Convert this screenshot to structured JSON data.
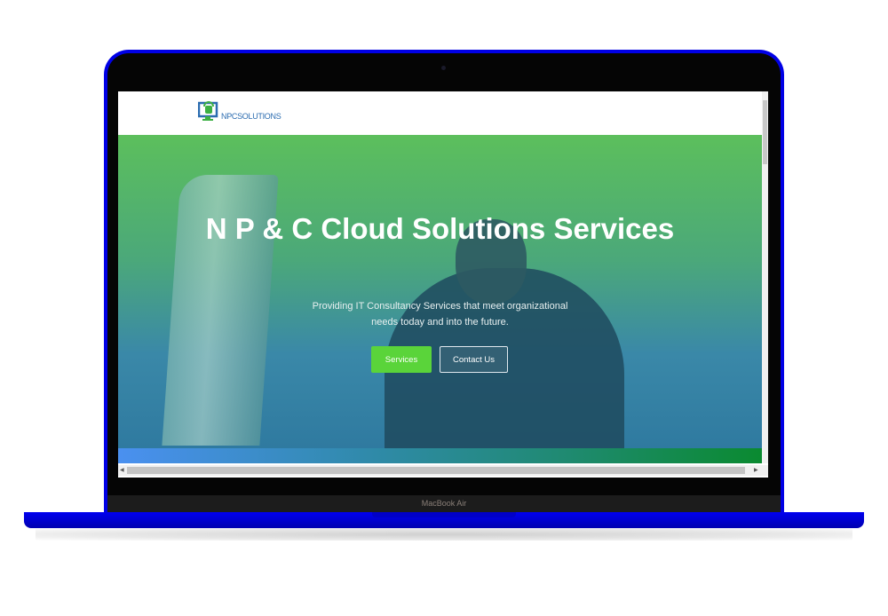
{
  "device": {
    "label": "MacBook Air",
    "shell_color": "#0000e6"
  },
  "site": {
    "logo_text": "NPCSOLUTIONS",
    "hero": {
      "title": "N P & C Cloud Solutions Services",
      "subtitle_line1": "Providing IT Consultancy Services that meet organizational",
      "subtitle_line2": "needs today and into the future.",
      "buttons": {
        "services": "Services",
        "contact": "Contact Us"
      }
    },
    "colors": {
      "accent": "#5ad43a",
      "logo": "#2b6cb0"
    }
  }
}
